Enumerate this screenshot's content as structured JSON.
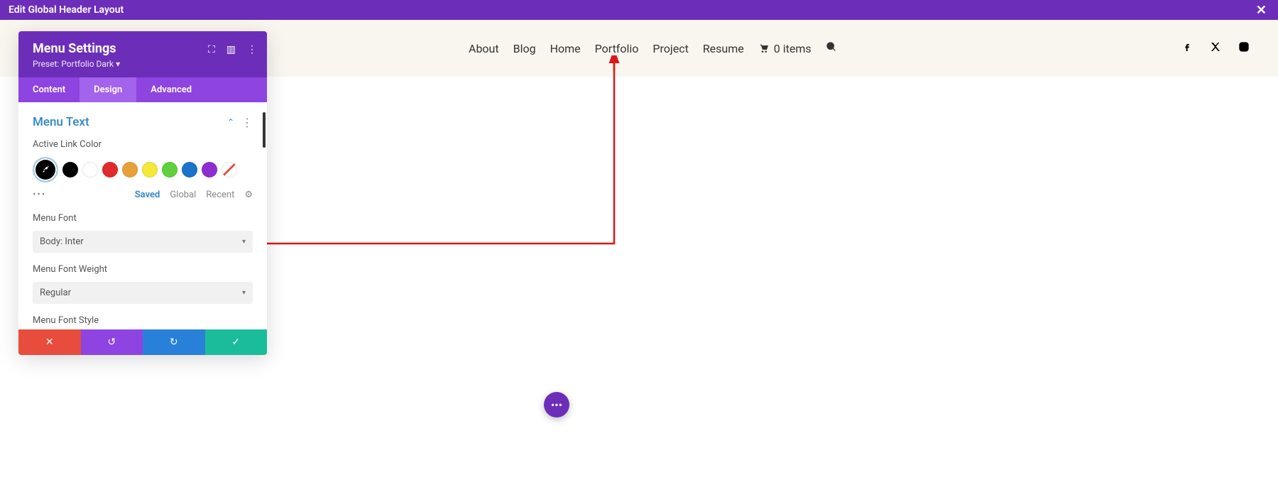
{
  "topbar": {
    "title": "Edit Global Header Layout"
  },
  "nav": {
    "items": [
      "About",
      "Blog",
      "Home",
      "Portfolio",
      "Project",
      "Resume"
    ],
    "cart_label": "0 items"
  },
  "panel": {
    "title": "Menu Settings",
    "preset": "Preset: Portfolio Dark ▾",
    "tabs": {
      "content": "Content",
      "design": "Design",
      "advanced": "Advanced",
      "active": 1
    },
    "section": "Menu Text",
    "active_link_color_label": "Active Link Color",
    "swatches": [
      "#000000",
      "#ffffff",
      "#e12a2a",
      "#e8a13a",
      "#f4e938",
      "#5fd13c",
      "#1a73c8",
      "#8e2ed1"
    ],
    "palette_tabs": {
      "saved": "Saved",
      "global": "Global",
      "recent": "Recent"
    },
    "menu_font_label": "Menu Font",
    "menu_font_value": "Body: Inter",
    "menu_font_weight_label": "Menu Font Weight",
    "menu_font_weight_value": "Regular",
    "menu_font_style_label": "Menu Font Style"
  },
  "colors": {
    "accent": "#6c2eb9",
    "arrow": "#e01616"
  }
}
